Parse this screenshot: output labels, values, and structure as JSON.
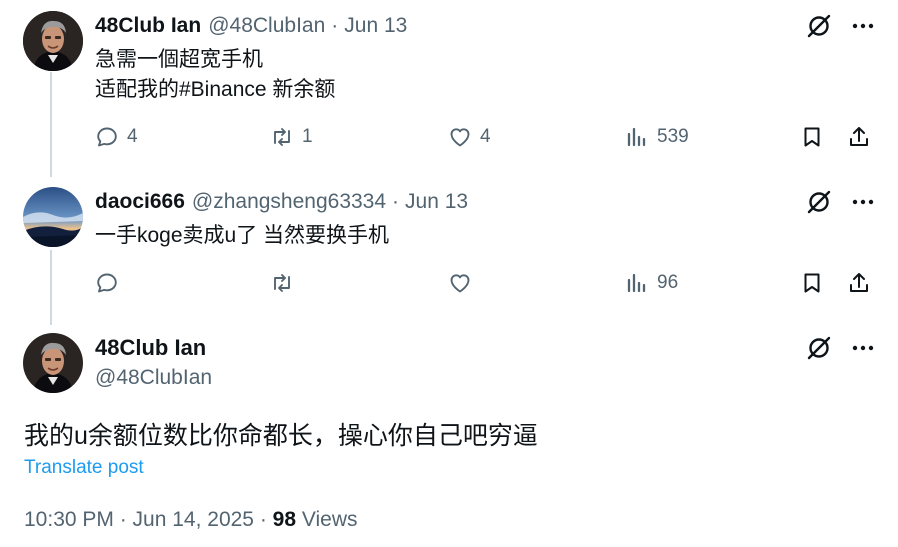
{
  "replies": [
    {
      "name": "48Club Ian",
      "handle": "@48ClubIan",
      "separator": "·",
      "time": "Jun 13",
      "lines": [
        "急需一個超宽手机",
        "适配我的#Binance 新余额"
      ],
      "reply_count": "4",
      "retweet_count": "1",
      "like_count": "4",
      "view_count": "539",
      "avatar_icon": "portrait-avatar-icon"
    },
    {
      "name": "daoci666",
      "handle": "@zhangsheng63334",
      "separator": "·",
      "time": "Jun 13",
      "lines": [
        "一手koge卖成u了 当然要换手机"
      ],
      "reply_count": "",
      "retweet_count": "",
      "like_count": "",
      "view_count": "96",
      "avatar_icon": "landscape-avatar-icon"
    }
  ],
  "main_post": {
    "name": "48Club Ian",
    "handle": "@48ClubIan",
    "text": "我的u余额位数比你命都长，操心你自己吧穷逼",
    "translate_label": "Translate post",
    "timestamp": "10:30 PM · Jun 14, 2025 · ",
    "views_count": "98",
    "views_label": " Views"
  },
  "colors": {
    "text": "#0f1419",
    "secondary": "#536471",
    "link": "#1d9bf0",
    "thread_line": "#cfd9de"
  }
}
